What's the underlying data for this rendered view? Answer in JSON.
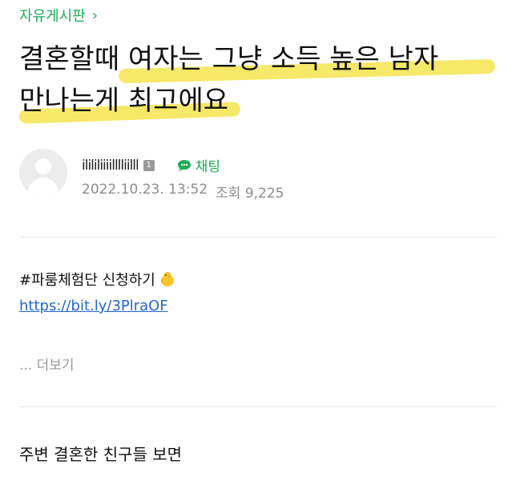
{
  "board": {
    "name": "자유게시판",
    "chevron": "›"
  },
  "post": {
    "title_line1": "결혼할때 여자는 그냥 소득 높은 남자",
    "title_line2": "만나는게 최고에요"
  },
  "author": {
    "avatar_icon": "default-avatar-icon",
    "nickname": "ilililiiiilllliilll",
    "level_badge": "1",
    "chat_label": "채팅",
    "chat_icon": "speech-bubble-icon",
    "date": "2022.10.23. 13:52",
    "views_label": "조회 9,225"
  },
  "content": {
    "tag": "#파룸체험단 신청하기",
    "emoji_icon": "chick-icon",
    "link": "https://bit.ly/3PlraOF",
    "more_label": "... 더보기",
    "body_first_line": "주변 결혼한 친구들 보면"
  },
  "colors": {
    "accent_green": "#1eab57",
    "highlight_yellow": "#f5e44d",
    "link_blue": "#2266cc"
  }
}
